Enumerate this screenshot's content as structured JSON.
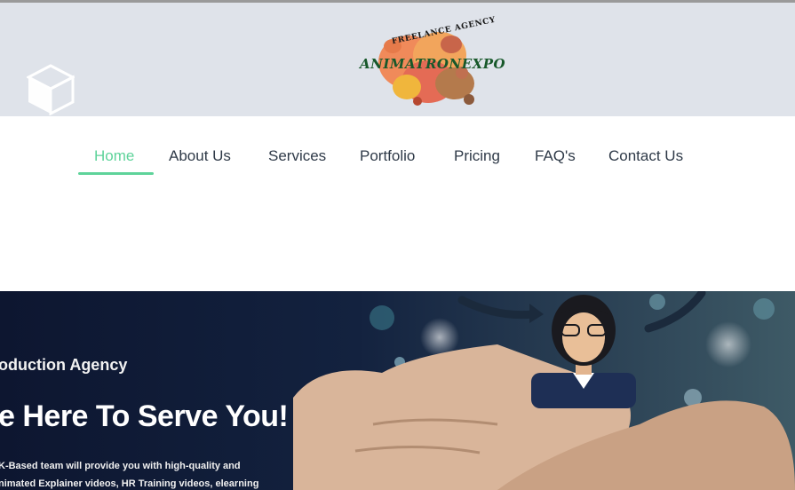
{
  "header": {
    "logo_top_text": "FREELANCE AGENCY",
    "logo_word": "ANIMATRONEXPO"
  },
  "nav": {
    "items": [
      {
        "label": "Home",
        "active": true
      },
      {
        "label": "About Us"
      },
      {
        "label": "Services"
      },
      {
        "label": "Portfolio"
      },
      {
        "label": "Pricing"
      },
      {
        "label": "FAQ's"
      },
      {
        "label": "Contact Us"
      }
    ],
    "accent": "#5ed39a"
  },
  "hero": {
    "subtitle": "oduction Agency",
    "title": "e Here To Serve You!",
    "body_lines": [
      "K-Based team will provide you with high-quality and",
      "nimated Explainer videos, HR Training videos, elearning"
    ]
  }
}
